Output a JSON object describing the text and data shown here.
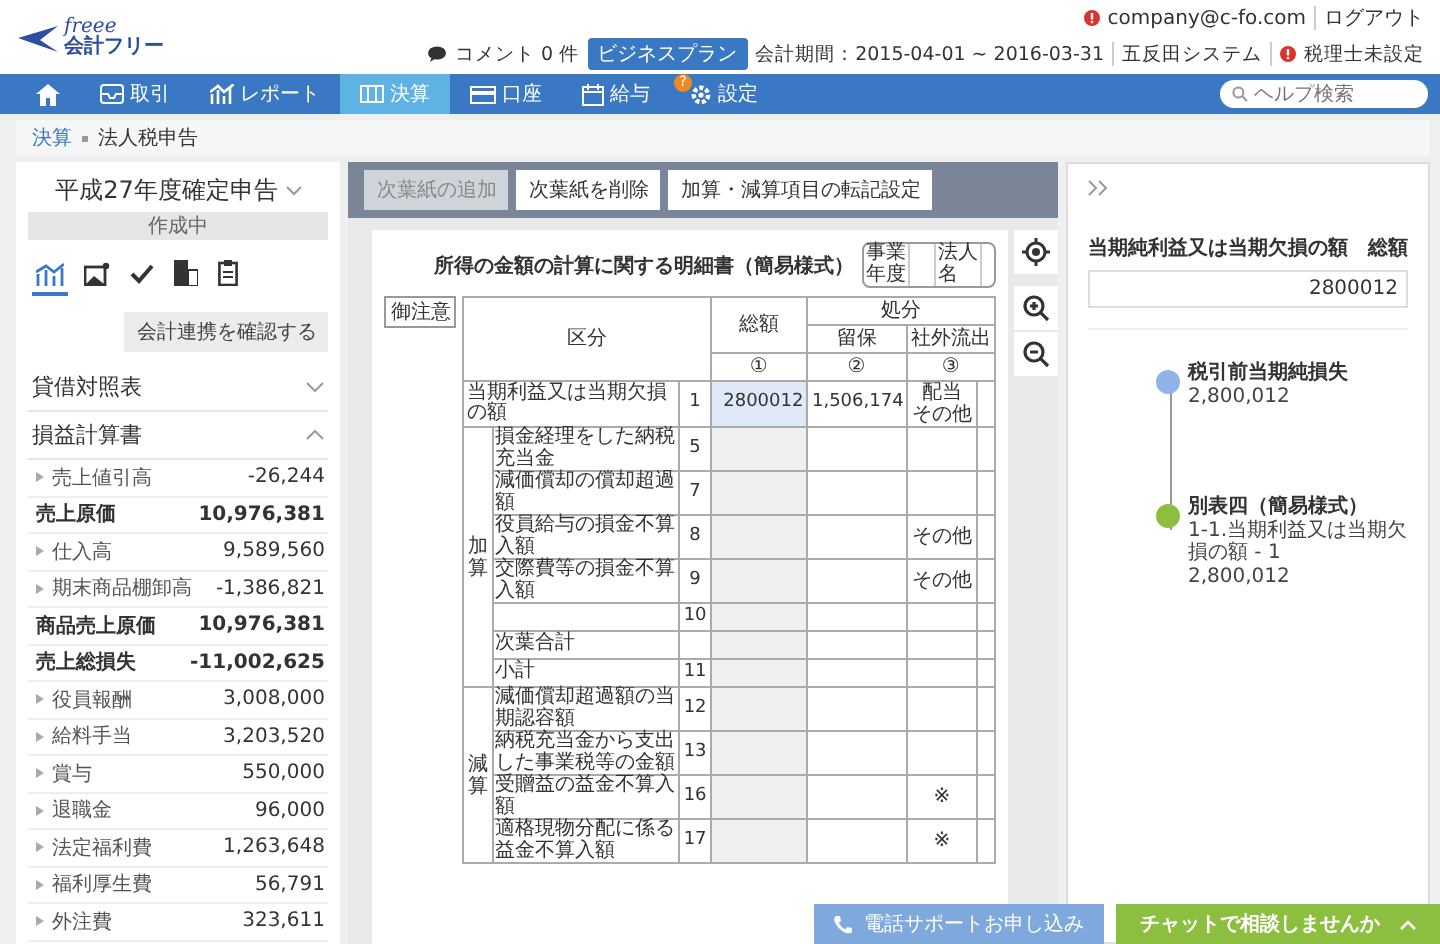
{
  "header": {
    "logo": {
      "wordmark": "freee",
      "name": "会計フリー"
    },
    "email": "company@c-fo.com",
    "logout": "ログアウト",
    "comment": "コメント 0 件",
    "plan": "ビジネスプラン",
    "period": "会計期間：2015-04-01 ~ 2016-03-31",
    "company": "五反田システム",
    "accountant": "税理士未設定"
  },
  "nav": {
    "items": [
      {
        "selected": false
      },
      {
        "label": "取引",
        "selected": false
      },
      {
        "label": "レポート",
        "selected": false
      },
      {
        "label": "決算",
        "selected": true
      },
      {
        "label": "口座",
        "selected": false
      },
      {
        "label": "給与",
        "selected": false
      },
      {
        "label": "設定",
        "badge": "?",
        "selected": false
      }
    ],
    "search": {
      "placeholder": "ヘルプ検索"
    }
  },
  "breadcrumb": [
    "決算",
    "法人税申告"
  ],
  "sidebar": {
    "title": "平成27年度確定申告",
    "status": "作成中",
    "tabs": [
      {
        "selected": true
      },
      {
        "selected": false
      },
      {
        "selected": false
      },
      {
        "selected": false
      },
      {
        "selected": false
      }
    ],
    "button": "会計連携を確認する",
    "sections": [
      {
        "title": "貸借対照表",
        "expanded": false
      },
      {
        "title": "損益計算書",
        "expanded": true,
        "items": [
          {
            "kind": "sub",
            "name": "売上値引高",
            "value": "-26,244"
          },
          {
            "kind": "total",
            "name": "売上原価",
            "value": "10,976,381"
          },
          {
            "kind": "sub",
            "name": "仕入高",
            "value": "9,589,560"
          },
          {
            "kind": "sub",
            "name": "期末商品棚卸高",
            "value": "-1,386,821"
          },
          {
            "kind": "total",
            "name": "商品売上原価",
            "value": "10,976,381"
          },
          {
            "kind": "total",
            "name": "売上総損失",
            "value": "-11,002,625"
          },
          {
            "kind": "sub",
            "name": "役員報酬",
            "value": "3,008,000"
          },
          {
            "kind": "sub",
            "name": "給料手当",
            "value": "3,203,520"
          },
          {
            "kind": "sub",
            "name": "賞与",
            "value": "550,000"
          },
          {
            "kind": "sub",
            "name": "退職金",
            "value": "96,000"
          },
          {
            "kind": "sub",
            "name": "法定福利費",
            "value": "1,263,648"
          },
          {
            "kind": "sub",
            "name": "福利厚生費",
            "value": "56,791"
          },
          {
            "kind": "sub",
            "name": "外注費",
            "value": "323,611"
          }
        ]
      }
    ]
  },
  "toolbar": {
    "buttons": [
      {
        "label": "次葉紙の追加",
        "disabled": true
      },
      {
        "label": "次葉紙を削除",
        "disabled": false
      },
      {
        "label": "加算・減算項目の転記設定",
        "disabled": false
      }
    ]
  },
  "form": {
    "title": "所得の金額の計算に関する明細書（簡易様式）",
    "year_label": "事業年度",
    "company_label": "法人名",
    "note": "御注意",
    "columns": {
      "section": "区分",
      "total": "総額",
      "disposal": "処分",
      "retained": "留保",
      "outflow": "社外流出",
      "marks": [
        "①",
        "②",
        "③"
      ]
    },
    "first_row": {
      "no": "1",
      "label": "当期利益又は当期欠損の額",
      "total": "2800012",
      "retained": "1,506,174",
      "outflow": [
        "配当",
        "その他"
      ]
    },
    "groups": [
      {
        "side": "加算",
        "rows": [
          {
            "no": "5",
            "label": "損金経理をした納税充当金"
          },
          {
            "no": "7",
            "label": "減価償却の償却超過額"
          },
          {
            "no": "8",
            "label": "役員給与の損金不算入額",
            "outflow": "その他"
          },
          {
            "no": "9",
            "label": "交際費等の損金不算入額",
            "outflow": "その他"
          },
          {
            "no": "10"
          },
          {
            "label": "次葉合計"
          },
          {
            "no": "11",
            "label": "小計"
          }
        ]
      },
      {
        "side": "減算",
        "rows": [
          {
            "no": "12",
            "label": "減価償却超過額の当期認容額"
          },
          {
            "no": "13",
            "label": "納税充当金から支出した事業税等の金額"
          },
          {
            "no": "16",
            "label": "受贈益の益金不算入額",
            "outflow": "※"
          },
          {
            "no": "17",
            "label": "適格現物分配に係る益金不算入額",
            "outflow": "※"
          }
        ]
      }
    ]
  },
  "right_panel": {
    "label": "当期純利益又は当期欠損の額　総額",
    "value": "2800012",
    "nodes": [
      {
        "title": "税引前当期純損失",
        "lines": [
          "2,800,012"
        ],
        "color": "#8fb3e8"
      },
      {
        "title": "別表四（簡易様式）",
        "lines": [
          "1-1.当期利益又は当期欠損の額 - 1",
          "2,800,012"
        ],
        "color": "#8cbf3f"
      }
    ]
  },
  "support": {
    "phone": "電話サポートお申し込み",
    "chat": "チャットで相談しませんか"
  }
}
